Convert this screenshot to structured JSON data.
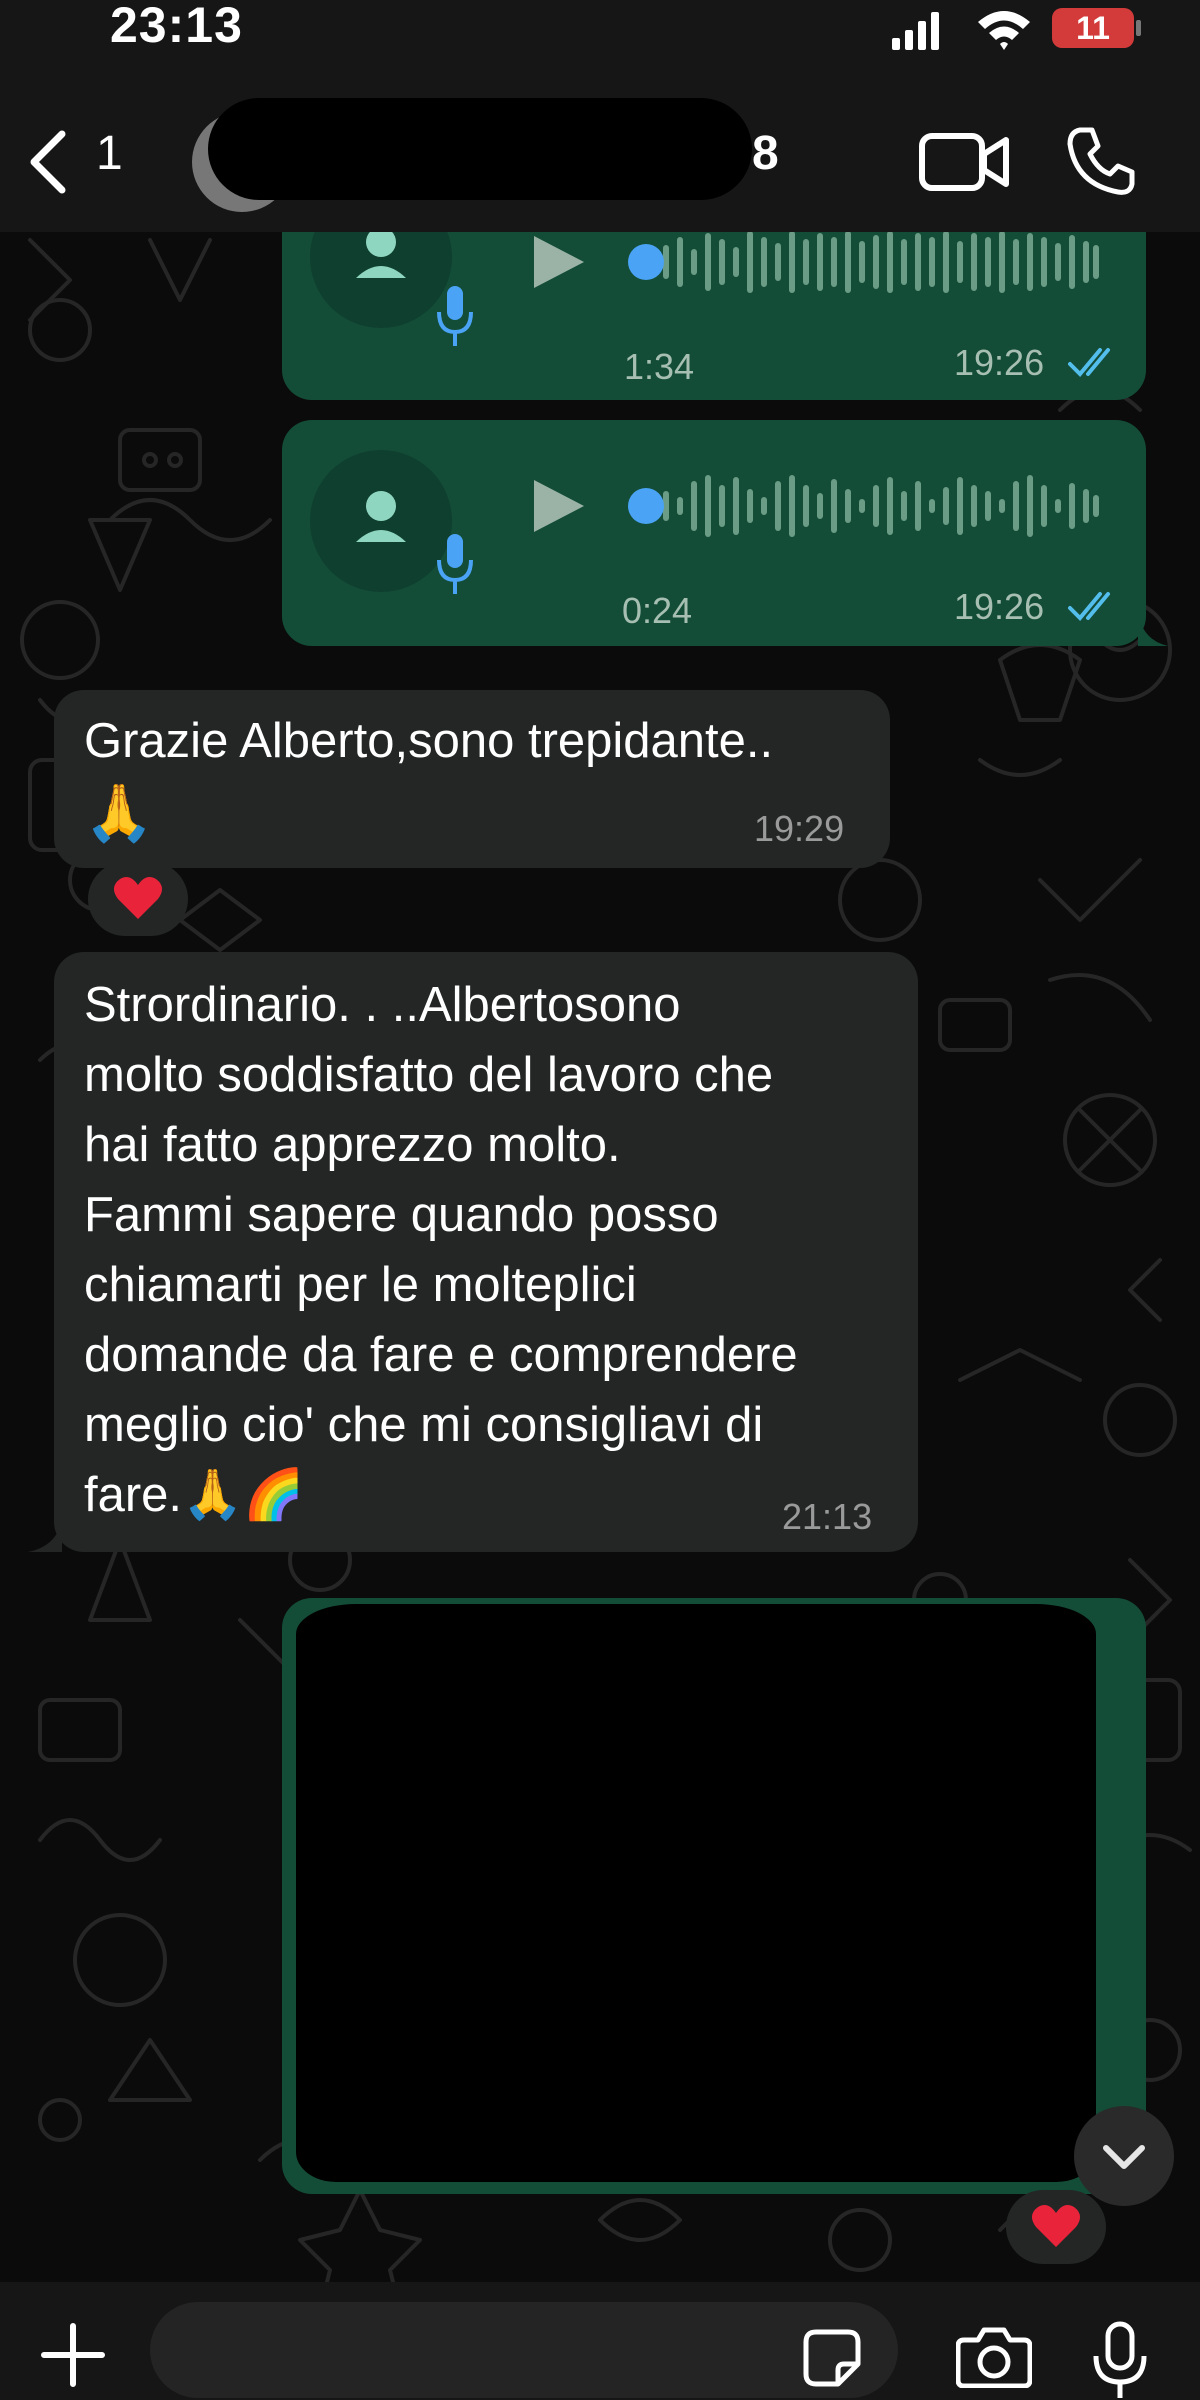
{
  "status_bar": {
    "time": "23:13",
    "battery_level": "11",
    "battery_color": "#d33b3b"
  },
  "header": {
    "back_count": "1",
    "contact_name_visible_suffix": "8",
    "icons": [
      "back-chevron-icon",
      "video-call-icon",
      "phone-call-icon"
    ]
  },
  "colors": {
    "outgoing_bubble": "#134d37",
    "incoming_bubble": "#242626",
    "read_ticks": "#53bdeb",
    "playhead": "#4aa3f5",
    "background": "#0b0b0b"
  },
  "messages": [
    {
      "type": "voice",
      "direction": "out",
      "duration": "1:34",
      "time": "19:26",
      "status": "read"
    },
    {
      "type": "voice",
      "direction": "out",
      "duration": "0:24",
      "time": "19:26",
      "status": "read"
    },
    {
      "type": "text",
      "direction": "in",
      "lines": [
        "Grazie Alberto,sono trepidante..",
        "🙏"
      ],
      "time": "19:29",
      "reaction": "❤️"
    },
    {
      "type": "text",
      "direction": "in",
      "lines": [
        "Strordinario. . ..Albertosono",
        "molto soddisfatto del lavoro che",
        "hai fatto apprezzo molto.",
        "Fammi sapere quando posso",
        "chiamarti per le molteplici",
        "domande da fare e comprendere",
        "meglio cio' che mi consigliavi di",
        "fare.🙏🌈"
      ],
      "time": "21:13"
    },
    {
      "type": "media",
      "direction": "out",
      "reaction": "❤️"
    }
  ],
  "input_bar": {
    "placeholder": "",
    "icons": [
      "plus-icon",
      "sticker-icon",
      "camera-icon",
      "microphone-icon"
    ]
  }
}
